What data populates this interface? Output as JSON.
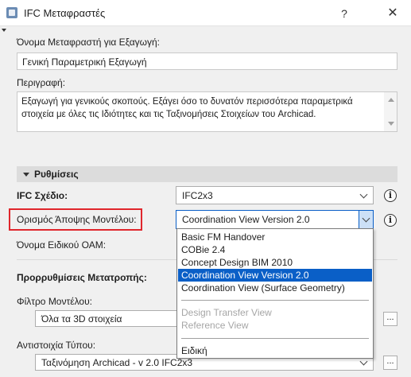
{
  "window": {
    "title": "IFC Μεταφραστές",
    "help_glyph": "?",
    "close_glyph": "✕"
  },
  "export_name": {
    "label": "Όνομα Μεταφραστή για Εξαγωγή:",
    "value": "Γενική Παραμετρική Εξαγωγή"
  },
  "description": {
    "label": "Περιγραφή:",
    "value": "Εξαγωγή για γενικούς σκοπούς. Εξάγει όσο το δυνατόν περισσότερα παραμετρικά στοιχεία με όλες τις Ιδιότητες και τις Ταξινομήσεις Στοιχείων του Archicad."
  },
  "settings": {
    "section_label": "Ρυθμίσεις",
    "ifc_schema": {
      "label": "IFC Σχέδιο:",
      "value": "IFC2x3"
    },
    "model_view": {
      "label": "Ορισμός Άποψης Μοντέλου:",
      "value": "Coordination View Version 2.0"
    },
    "oam_name": {
      "label": "Όνομα Ειδικού ΟΑΜ:"
    },
    "info_glyph": "i"
  },
  "presets": {
    "title": "Προρρυθμίσεις Μετατροπής:",
    "model_filter": {
      "label": "Φίλτρο Μοντέλου:",
      "value": "Όλα τα 3D στοιχεία"
    },
    "type_mapping": {
      "label": "Αντιστοιχία Τύπου:",
      "value": "Ταξινόμηση Archicad - v 2.0 IFC2x3"
    },
    "more_glyph": "..."
  },
  "dropdown": {
    "items": [
      {
        "label": "Basic FM Handover",
        "state": "normal"
      },
      {
        "label": "COBie 2.4",
        "state": "normal"
      },
      {
        "label": "Concept Design BIM 2010",
        "state": "normal"
      },
      {
        "label": "Coordination View Version 2.0",
        "state": "selected"
      },
      {
        "label": "Coordination View (Surface Geometry)",
        "state": "normal"
      },
      {
        "label": "Design Transfer View",
        "state": "disabled"
      },
      {
        "label": "Reference View",
        "state": "disabled"
      },
      {
        "label": "Ειδική",
        "state": "normal"
      }
    ]
  },
  "colors": {
    "highlight": "#e0262c",
    "selection": "#0a5fc7"
  }
}
